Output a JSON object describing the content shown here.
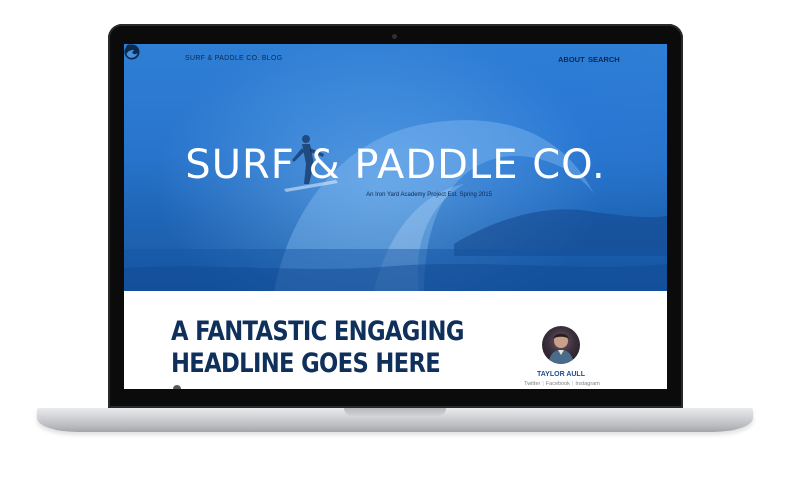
{
  "nav": {
    "blog_title": "SURF & PADDLE CO. BLOG",
    "about": "ABOUT",
    "search": "SEARCH",
    "logo_icon": "wave-logo-icon",
    "search_icon": "search-icon"
  },
  "hero": {
    "title": "SURF & PADDLE CO.",
    "subtitle": "An Iron Yard Academy Project Est. Spring 2015"
  },
  "article": {
    "headline_line1": "A FANTASTIC ENGAGING",
    "headline_line2": "HEADLINE GOES HERE"
  },
  "author": {
    "name": "TAYLOR AULL",
    "social": [
      "Twitter",
      "Facebook",
      "Instagram"
    ]
  },
  "colors": {
    "hero_blue": "#2874cc",
    "headline_navy": "#10305c",
    "author_blue": "#1d4f8c"
  }
}
